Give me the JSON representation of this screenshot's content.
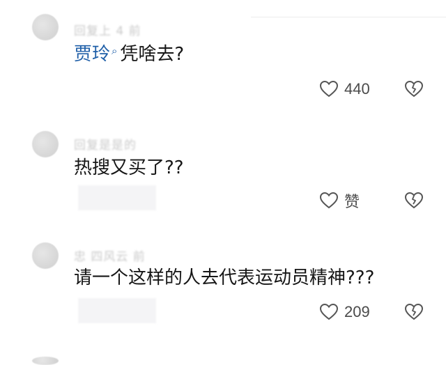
{
  "comments": [
    {
      "meta_blurred": "回复上 4 前",
      "mention": "贾玲",
      "search_mark": "ꟴ",
      "text": "凭啥去?",
      "like_count": "440"
    },
    {
      "meta_blurred": "回复是是的",
      "text": "热搜又买了??",
      "like_count": "赞"
    },
    {
      "meta_blurred": "忠 四风云 前",
      "text": "请一个这样的人去代表运动员精神???",
      "like_count": "209"
    }
  ],
  "icons": {
    "like": "heart-outline-icon",
    "dislike": "broken-heart-icon"
  }
}
